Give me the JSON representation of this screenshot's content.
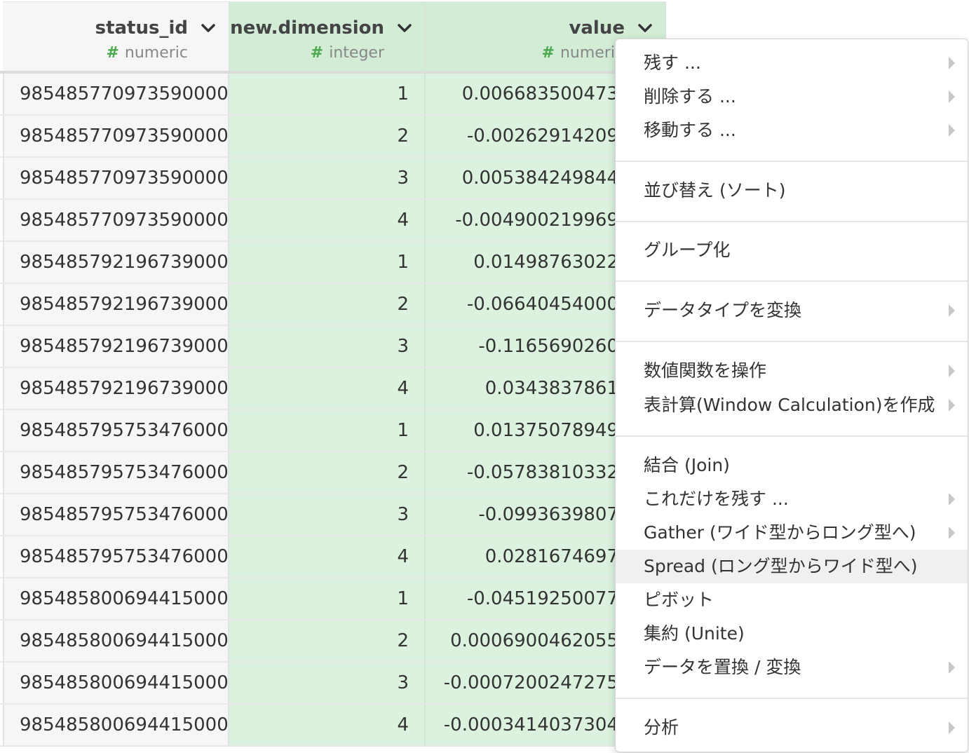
{
  "columns": [
    {
      "name": "status_id",
      "type": "numeric"
    },
    {
      "name": "new.dimension",
      "type": "integer"
    },
    {
      "name": "value",
      "type": "numeri"
    }
  ],
  "type_icon": "#",
  "rows": [
    {
      "status_id": "985485770973590000",
      "dim": "1",
      "value": "0.006683500473"
    },
    {
      "status_id": "985485770973590000",
      "dim": "2",
      "value": "-0.00262914209"
    },
    {
      "status_id": "985485770973590000",
      "dim": "3",
      "value": "0.005384249844"
    },
    {
      "status_id": "985485770973590000",
      "dim": "4",
      "value": "-0.004900219969"
    },
    {
      "status_id": "985485792196739000",
      "dim": "1",
      "value": "0.01498763022"
    },
    {
      "status_id": "985485792196739000",
      "dim": "2",
      "value": "-0.06640454000"
    },
    {
      "status_id": "985485792196739000",
      "dim": "3",
      "value": "-0.1165690260"
    },
    {
      "status_id": "985485792196739000",
      "dim": "4",
      "value": "0.0343837861"
    },
    {
      "status_id": "985485795753476000",
      "dim": "1",
      "value": "0.01375078949"
    },
    {
      "status_id": "985485795753476000",
      "dim": "2",
      "value": "-0.05783810332"
    },
    {
      "status_id": "985485795753476000",
      "dim": "3",
      "value": "-0.0993639807"
    },
    {
      "status_id": "985485795753476000",
      "dim": "4",
      "value": "0.0281674697"
    },
    {
      "status_id": "985485800694415000",
      "dim": "1",
      "value": "-0.04519250077"
    },
    {
      "status_id": "985485800694415000",
      "dim": "2",
      "value": "0.0006900462055"
    },
    {
      "status_id": "985485800694415000",
      "dim": "3",
      "value": "-0.0007200247275"
    },
    {
      "status_id": "985485800694415000",
      "dim": "4",
      "value": "-0.0003414037304"
    }
  ],
  "menu": {
    "items": [
      {
        "label": "残す ...",
        "submenu": true
      },
      {
        "label": "削除する ...",
        "submenu": true
      },
      {
        "label": "移動する ...",
        "submenu": true
      },
      {
        "label": "並び替え (ソート)",
        "submenu": false
      },
      {
        "label": "グループ化",
        "submenu": false
      },
      {
        "label": "データタイプを変換",
        "submenu": true
      },
      {
        "label": "数値関数を操作",
        "submenu": true
      },
      {
        "label": "表計算(Window Calculation)を作成",
        "submenu": true
      },
      {
        "label": "結合 (Join)",
        "submenu": false
      },
      {
        "label": "これだけを残す ...",
        "submenu": true
      },
      {
        "label": "Gather (ワイド型からロング型へ)",
        "submenu": true
      },
      {
        "label": "Spread (ロング型からワイド型へ)",
        "submenu": false,
        "highlighted": true
      },
      {
        "label": "ピボット",
        "submenu": false
      },
      {
        "label": "集約 (Unite)",
        "submenu": false
      },
      {
        "label": "データを置換 / 変換",
        "submenu": true
      },
      {
        "label": "分析",
        "submenu": true
      }
    ]
  }
}
